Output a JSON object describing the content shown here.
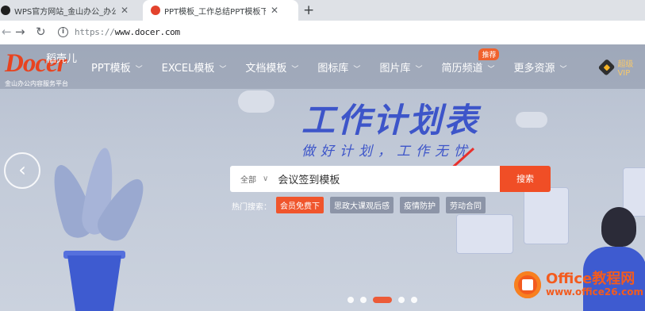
{
  "browser": {
    "tabs": [
      {
        "title": "WPS官方网站_金山办公_办公软件",
        "active": false,
        "favicon": "wps-favicon"
      },
      {
        "title": "PPT模板_工作总结PPT模板下载_",
        "active": true,
        "favicon": "docer-favicon"
      }
    ],
    "new_tab_label": "+",
    "url_scheme": "https://",
    "url_host": "www.docer.com"
  },
  "site": {
    "logo_word": "Docer",
    "logo_cn": "稻壳儿",
    "logo_sub": "金山办公内容服务平台",
    "nav": [
      {
        "label": "PPT模板"
      },
      {
        "label": "EXCEL模板"
      },
      {
        "label": "文档模板"
      },
      {
        "label": "图标库"
      },
      {
        "label": "图片库"
      },
      {
        "label": "简历频道",
        "badge": "推荐"
      },
      {
        "label": "更多资源"
      }
    ],
    "vip_label": "超级VIP"
  },
  "hero": {
    "title": "工作计划表",
    "slogan": "做好计划，工作无忧"
  },
  "search": {
    "scope": "全部",
    "value": "会议签到模板",
    "button": "搜索",
    "hot_label": "热门搜索：",
    "hot_tags": [
      "会员免费下",
      "思政大课观后感",
      "疫情防护",
      "劳动合同"
    ]
  },
  "carousel": {
    "count": 5,
    "active_index": 2
  },
  "watermark": {
    "line1": "Office教程网",
    "line2": "www.office26.com"
  },
  "colors": {
    "accent": "#f04e26",
    "hero_blue": "#3d55c9"
  }
}
